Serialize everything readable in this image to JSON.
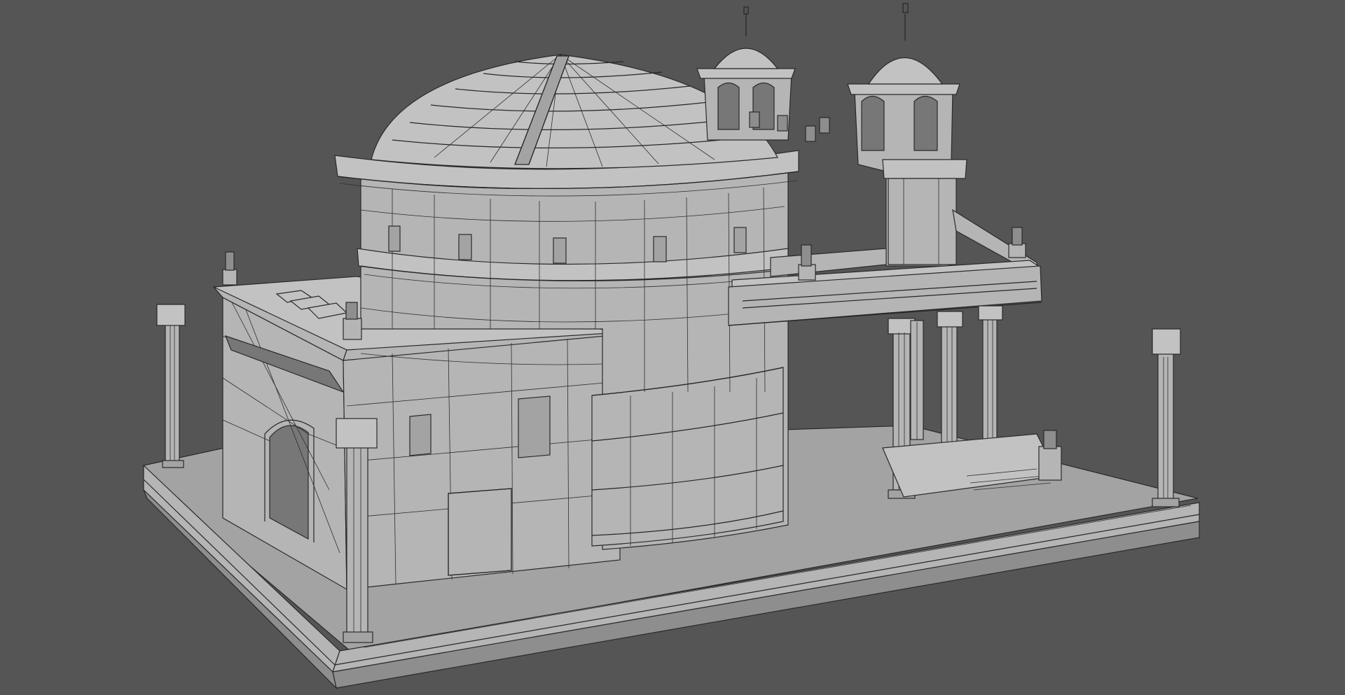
{
  "viewport": {
    "background_color": "#555555",
    "render_mode": "shaded-wireframe"
  },
  "model": {
    "subject": "pantheon-style-domed-temple",
    "material_color": "#b5b5b5",
    "wire_color": "#262626",
    "column_count_free_standing": 4,
    "portico_column_count": 4,
    "bell_tower_count": 2
  }
}
